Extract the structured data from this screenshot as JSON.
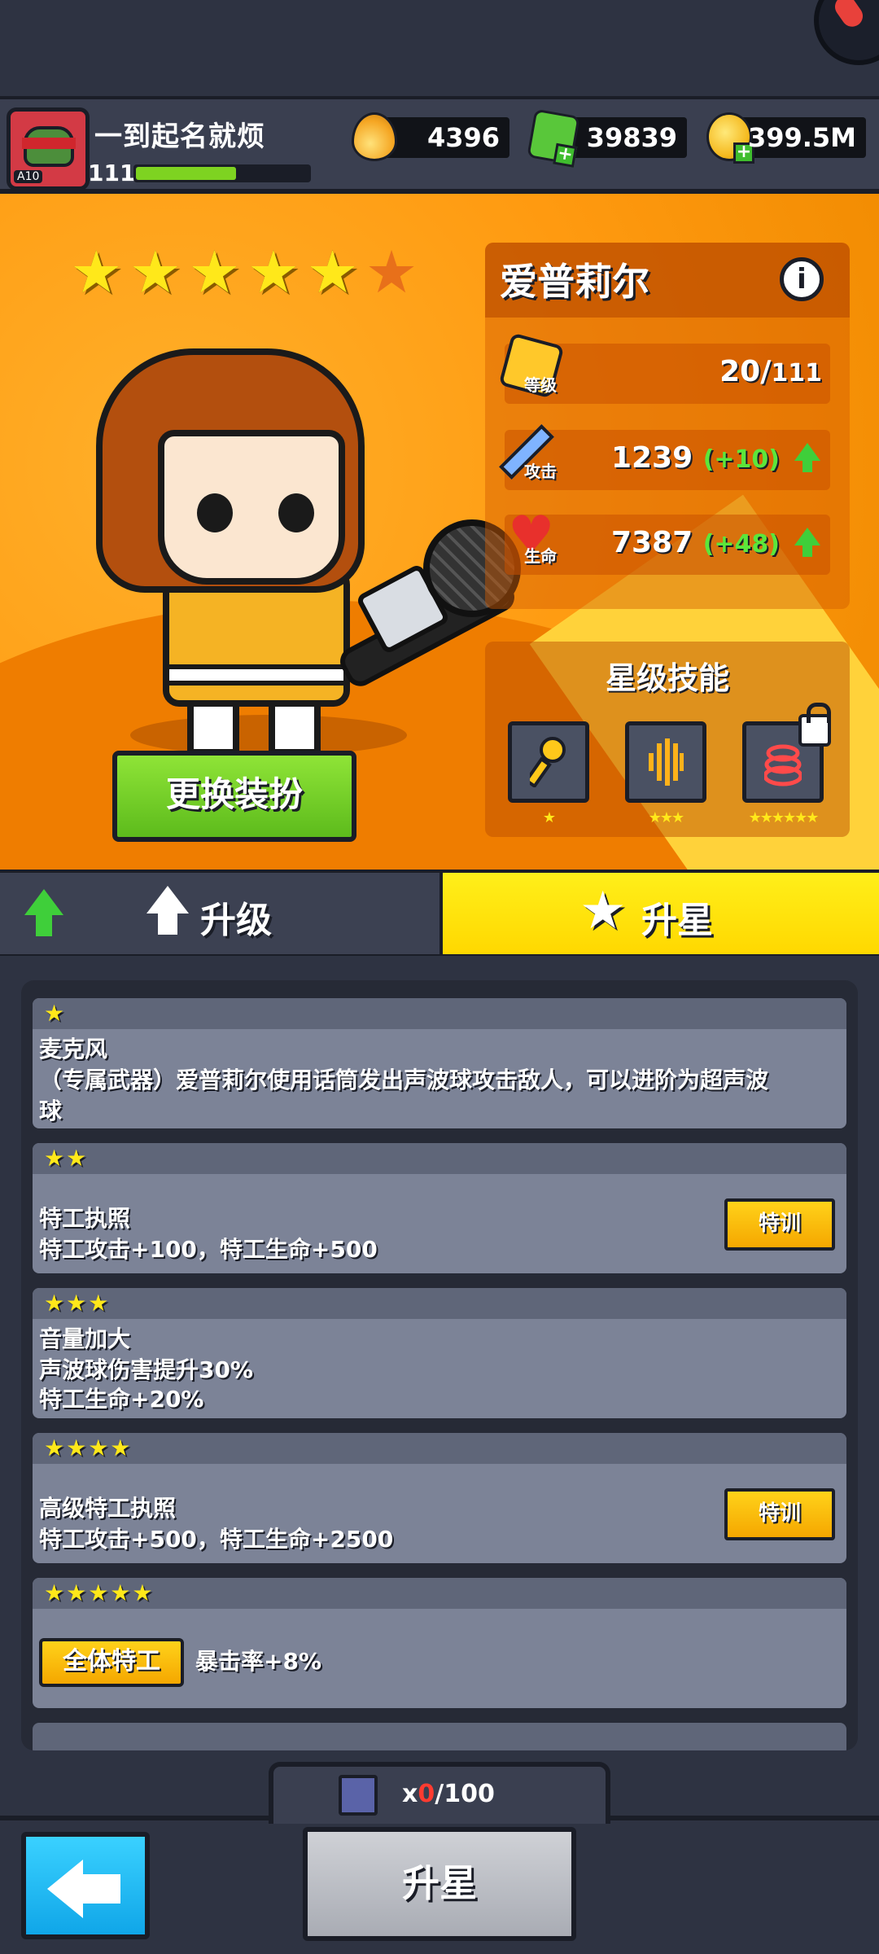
{
  "player": {
    "name": "一到起名就烦",
    "level": "111",
    "avatar_tag": "A10",
    "xp_fraction": 0.58
  },
  "resources": {
    "fuel": "4396",
    "gems": "39839",
    "coins": "399.5M"
  },
  "hero": {
    "name": "爱普莉尔",
    "stars_filled": 5,
    "stars_total": 6,
    "change_outfit_label": "更换装扮",
    "stats": {
      "level_label": "等级",
      "level": "20/",
      "level_max": "111",
      "attack_label": "攻击",
      "attack": "1239",
      "attack_bonus": "(+10)",
      "hp_label": "生命",
      "hp": "7387",
      "hp_bonus": "(+48)"
    },
    "skills": {
      "title": "星级技能",
      "items": [
        {
          "icon": "microphone-icon",
          "stars": "★"
        },
        {
          "icon": "sound-wave-icon",
          "stars": "★★★"
        },
        {
          "icon": "sonic-ring-icon",
          "stars": "★★★★★★",
          "locked": true
        }
      ]
    }
  },
  "tabs": {
    "upgrade": "升级",
    "star_up": "升星",
    "active": "star_up"
  },
  "star_list": [
    {
      "stars": "★",
      "title": "麦克风",
      "desc": [
        "（专属武器）爱普莉尔使用话筒发出声波球攻击敌人，可以进阶为超声波",
        "球"
      ],
      "button": ""
    },
    {
      "stars": "★★",
      "title": "特工执照",
      "desc": [
        "特工攻击+100，特工生命+500"
      ],
      "button": "特训"
    },
    {
      "stars": "★★★",
      "title": "音量加大",
      "desc": [
        "声波球伤害提升30%",
        "特工生命+20%"
      ],
      "button": ""
    },
    {
      "stars": "★★★★",
      "title": "高级特工执照",
      "desc": [
        "特工攻击+500，特工生命+2500"
      ],
      "button": "特训"
    },
    {
      "stars": "★★★★★",
      "tag": "全体特工",
      "desc": [
        "暴击率+8%"
      ]
    }
  ],
  "cost": {
    "prefix": "x",
    "have": "0",
    "need": "/100"
  },
  "bottom": {
    "star_up_button": "升星"
  },
  "colors": {
    "accent_yellow": "#ffe81a",
    "bonus_green": "#5ce63b",
    "cost_red": "#ff3b30",
    "hero_bg": "#ff9a10"
  }
}
